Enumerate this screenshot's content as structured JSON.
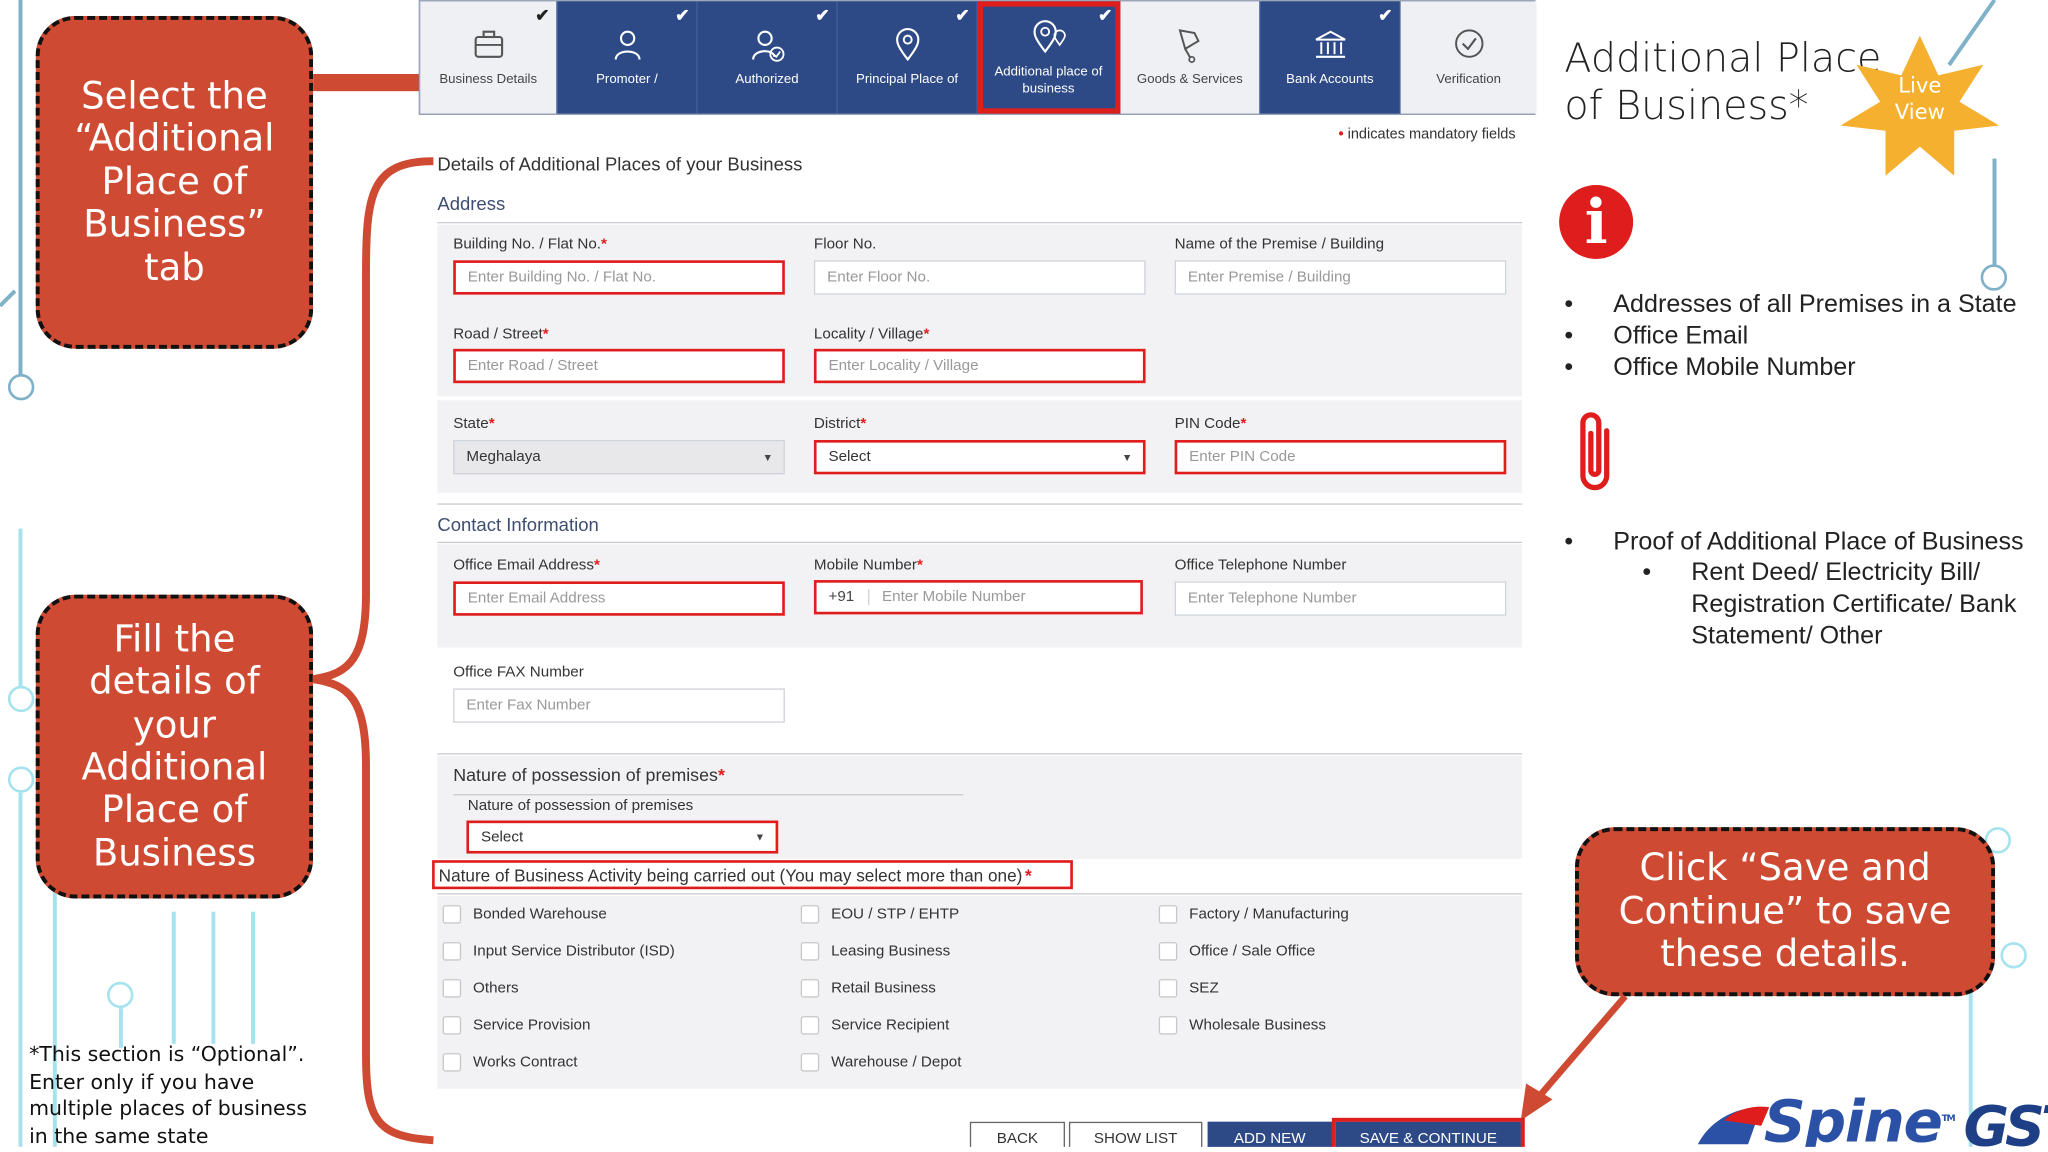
{
  "callouts": {
    "select_tab": [
      "Select the",
      "“Additional",
      "Place of",
      "Business”",
      "tab"
    ],
    "fill_details": [
      "Fill the",
      "details of",
      "your",
      "Additional",
      "Place of",
      "Business"
    ],
    "save_continue": [
      "Click “Save and",
      "Continue” to save",
      "these details."
    ]
  },
  "tabs": [
    {
      "label": "Business Details",
      "icon": "briefcase-icon",
      "done": true
    },
    {
      "label": "Promoter /",
      "icon": "person-icon",
      "done": true
    },
    {
      "label": "Authorized",
      "icon": "person-check-icon",
      "done": true
    },
    {
      "label": "Principal Place of",
      "icon": "location-pin-icon",
      "done": true
    },
    {
      "label": "Additional place of business",
      "icon": "multi-location-icon",
      "done": true,
      "active": true
    },
    {
      "label": "Goods & Services",
      "icon": "cart-icon",
      "done": false
    },
    {
      "label": "Bank Accounts",
      "icon": "bank-icon",
      "done": true
    },
    {
      "label": "Verification",
      "icon": "check-circle-icon",
      "done": false
    }
  ],
  "mandatory_note": {
    "mark": "•",
    "text": "indicates mandatory fields"
  },
  "form": {
    "title": "Details of Additional Places of your Business",
    "address_heading": "Address",
    "contact_heading": "Contact Information",
    "required_mark": "*",
    "building": {
      "label": "Building No. / Flat No.",
      "placeholder": "Enter Building No. / Flat No."
    },
    "floor": {
      "label": "Floor No.",
      "placeholder": "Enter Floor No."
    },
    "premise": {
      "label": "Name of the Premise / Building",
      "placeholder": "Enter Premise / Building"
    },
    "road": {
      "label": "Road / Street",
      "placeholder": "Enter Road / Street"
    },
    "locality": {
      "label": "Locality / Village",
      "placeholder": "Enter Locality / Village"
    },
    "state": {
      "label": "State",
      "value": "Meghalaya"
    },
    "district": {
      "label": "District",
      "value": "Select"
    },
    "pin": {
      "label": "PIN Code",
      "placeholder": "Enter PIN Code"
    },
    "email": {
      "label": "Office Email Address",
      "placeholder": "Enter Email Address"
    },
    "mobile": {
      "label": "Mobile Number",
      "prefix": "+91",
      "placeholder": "Enter Mobile Number"
    },
    "telephone": {
      "label": "Office Telephone Number",
      "placeholder": "Enter Telephone Number"
    },
    "fax": {
      "label": "Office FAX Number",
      "placeholder": "Enter Fax Number"
    },
    "possession_heading": "Nature of possession of premises",
    "possession": {
      "label": "Nature of possession of premises",
      "value": "Select"
    },
    "nob_heading": "Nature of Business Activity being carried out (You may select more than one)",
    "activities": [
      [
        "Bonded Warehouse",
        "EOU / STP / EHTP",
        "Factory / Manufacturing"
      ],
      [
        "Input Service Distributor (ISD)",
        "Leasing Business",
        "Office / Sale Office"
      ],
      [
        "Others",
        "Retail Business",
        "SEZ"
      ],
      [
        "Service Provision",
        "Service Recipient",
        "Wholesale Business"
      ],
      [
        "Works Contract",
        "Warehouse / Depot"
      ]
    ]
  },
  "buttons": {
    "back": "BACK",
    "show_list": "SHOW LIST",
    "add_new": "ADD NEW",
    "save_continue": "SAVE & CONTINUE"
  },
  "right": {
    "title_lines": [
      "Additional Place",
      "of Business*"
    ],
    "badge": [
      "Live",
      "View"
    ],
    "info_glyph": "i",
    "info_items": [
      "Addresses of all Premises in a State",
      "Office Email",
      "Office Mobile Number"
    ],
    "proof_item": "Proof of Additional Place of Business",
    "proof_sub": [
      "Rent Deed/ Electricity Bill/",
      "Registration Certificate/ Bank",
      "Statement/ Other"
    ]
  },
  "footnote": [
    "*This section is “Optional”.",
    "Enter only if you have",
    "multiple places of business",
    "in the same state"
  ],
  "logos": {
    "spine": "Spine",
    "spine_tm": "TM",
    "gst": "GST"
  },
  "colors": {
    "accent_navy": "#2d4a87",
    "callout_red": "#cf4a32",
    "mandatory_red": "#e01d1d",
    "badge_gold": "#f5b030"
  }
}
